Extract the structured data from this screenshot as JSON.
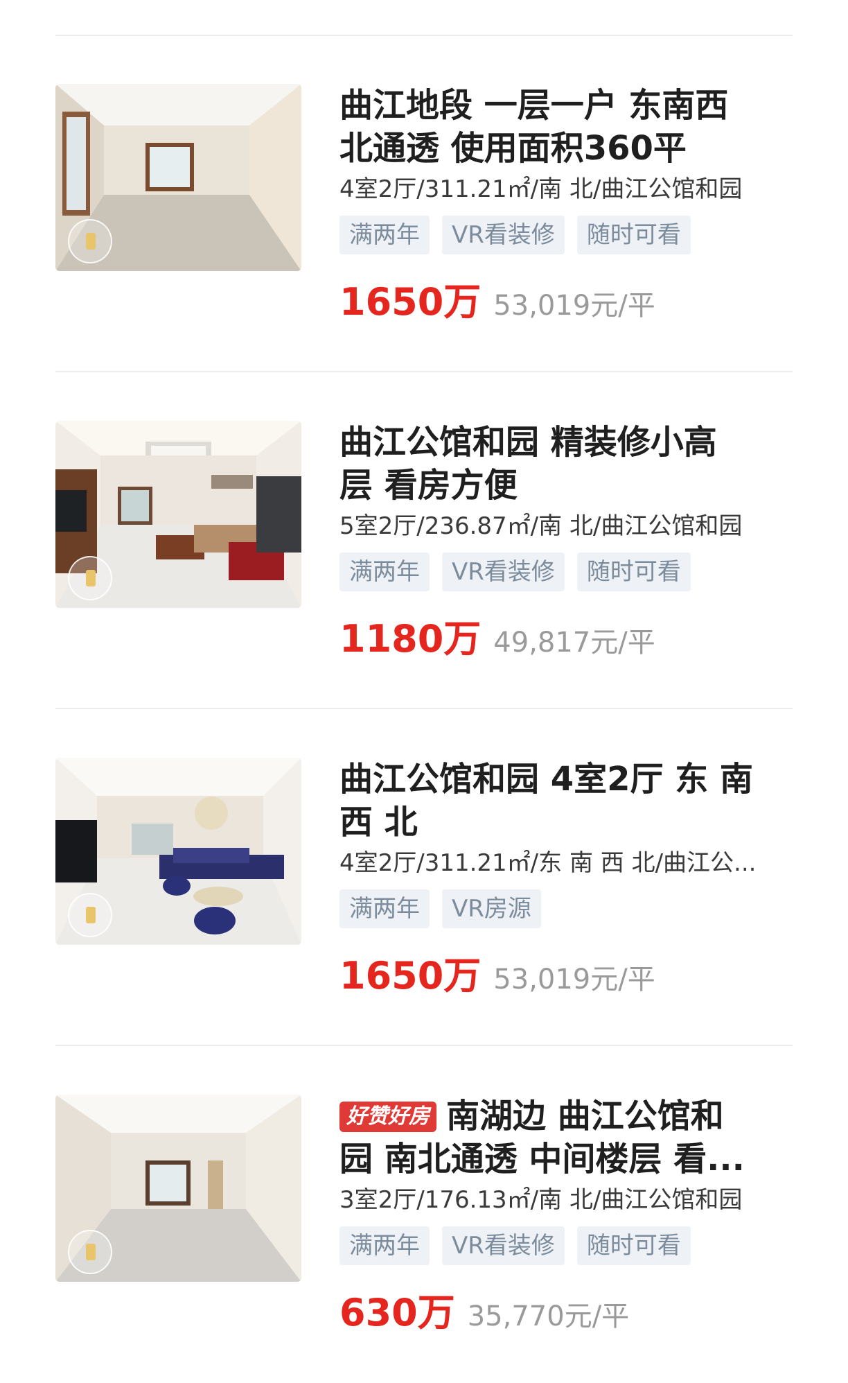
{
  "listings": [
    {
      "title_line1": "曲江地段 一层一户 东南西",
      "title_line2": "北通透 使用面积360平",
      "meta": "4室2厅/311.21㎡/南 北/曲江公馆和园",
      "tags": [
        "满两年",
        "VR看装修",
        "随时可看"
      ],
      "price": "1650万",
      "unit_price": "53,019元/平"
    },
    {
      "title_line1": "曲江公馆和园 精装修小高",
      "title_line2": "层 看房方便",
      "meta": "5室2厅/236.87㎡/南 北/曲江公馆和园",
      "tags": [
        "满两年",
        "VR看装修",
        "随时可看"
      ],
      "price": "1180万",
      "unit_price": "49,817元/平"
    },
    {
      "title_line1": "曲江公馆和园 4室2厅 东 南",
      "title_line2": "西 北",
      "meta": "4室2厅/311.21㎡/东 南 西 北/曲江公...",
      "tags": [
        "满两年",
        "VR房源"
      ],
      "price": "1650万",
      "unit_price": "53,019元/平"
    },
    {
      "hot_tag": "好赞好房",
      "title_line1": "南湖边 曲江公馆和",
      "title_line2": "园 南北通透 中间楼层 看...",
      "meta": "3室2厅/176.13㎡/南 北/曲江公馆和园",
      "tags": [
        "满两年",
        "VR看装修",
        "随时可看"
      ],
      "price": "630万",
      "unit_price": "35,770元/平"
    }
  ],
  "colors": {
    "price_red": "#e4261e",
    "tag_bg": "#eef2f6",
    "tag_text": "#7c8c9c",
    "hot_tag_bg": "#e03a36"
  }
}
